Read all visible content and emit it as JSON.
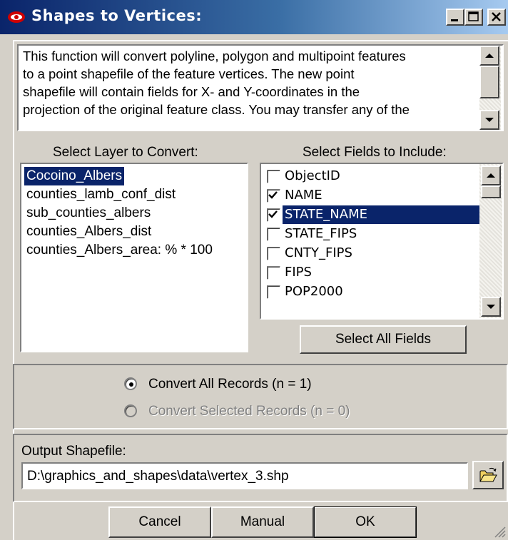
{
  "window": {
    "title": "Shapes to Vertices:",
    "icon": "red-eye-icon",
    "controls": [
      "minimize-icon",
      "maximize-icon",
      "close-icon"
    ]
  },
  "description": {
    "text": "This function will convert polyline, polygon and multipoint features\nto a point shapefile of the feature vertices.  The new point\nshapefile will contain fields for X- and Y-coordinates in the\nprojection of the original feature class.  You may transfer any of the"
  },
  "layers": {
    "label": "Select Layer to Convert:",
    "items": [
      "Cocoino_Albers",
      "counties_lamb_conf_dist",
      "sub_counties_albers",
      "counties_Albers_dist",
      "counties_Albers_area: % * 100"
    ],
    "selected_index": 0
  },
  "fields": {
    "label": "Select Fields to Include:",
    "items": [
      {
        "name": "ObjectID",
        "checked": false,
        "selected": false
      },
      {
        "name": "NAME",
        "checked": true,
        "selected": false
      },
      {
        "name": "STATE_NAME",
        "checked": true,
        "selected": true
      },
      {
        "name": "STATE_FIPS",
        "checked": false,
        "selected": false
      },
      {
        "name": "CNTY_FIPS",
        "checked": false,
        "selected": false
      },
      {
        "name": "FIPS",
        "checked": false,
        "selected": false
      },
      {
        "name": "POP2000",
        "checked": false,
        "selected": false
      }
    ],
    "select_all_label": "Select All Fields"
  },
  "records": {
    "all_label": "Convert All Records (n = 1)",
    "selected_label": "Convert Selected Records (n = 0)",
    "choice": "all"
  },
  "output": {
    "label": "Output Shapefile:",
    "value": "D:\\graphics_and_shapes\\data\\vertex_3.shp",
    "browse_icon": "open-folder-icon"
  },
  "buttons": {
    "cancel": "Cancel",
    "manual": "Manual",
    "ok": "OK"
  },
  "colors": {
    "titlebar_start": "#0a246a",
    "titlebar_end": "#a6caf0",
    "selection": "#0a246a",
    "face": "#d4d0c8"
  }
}
